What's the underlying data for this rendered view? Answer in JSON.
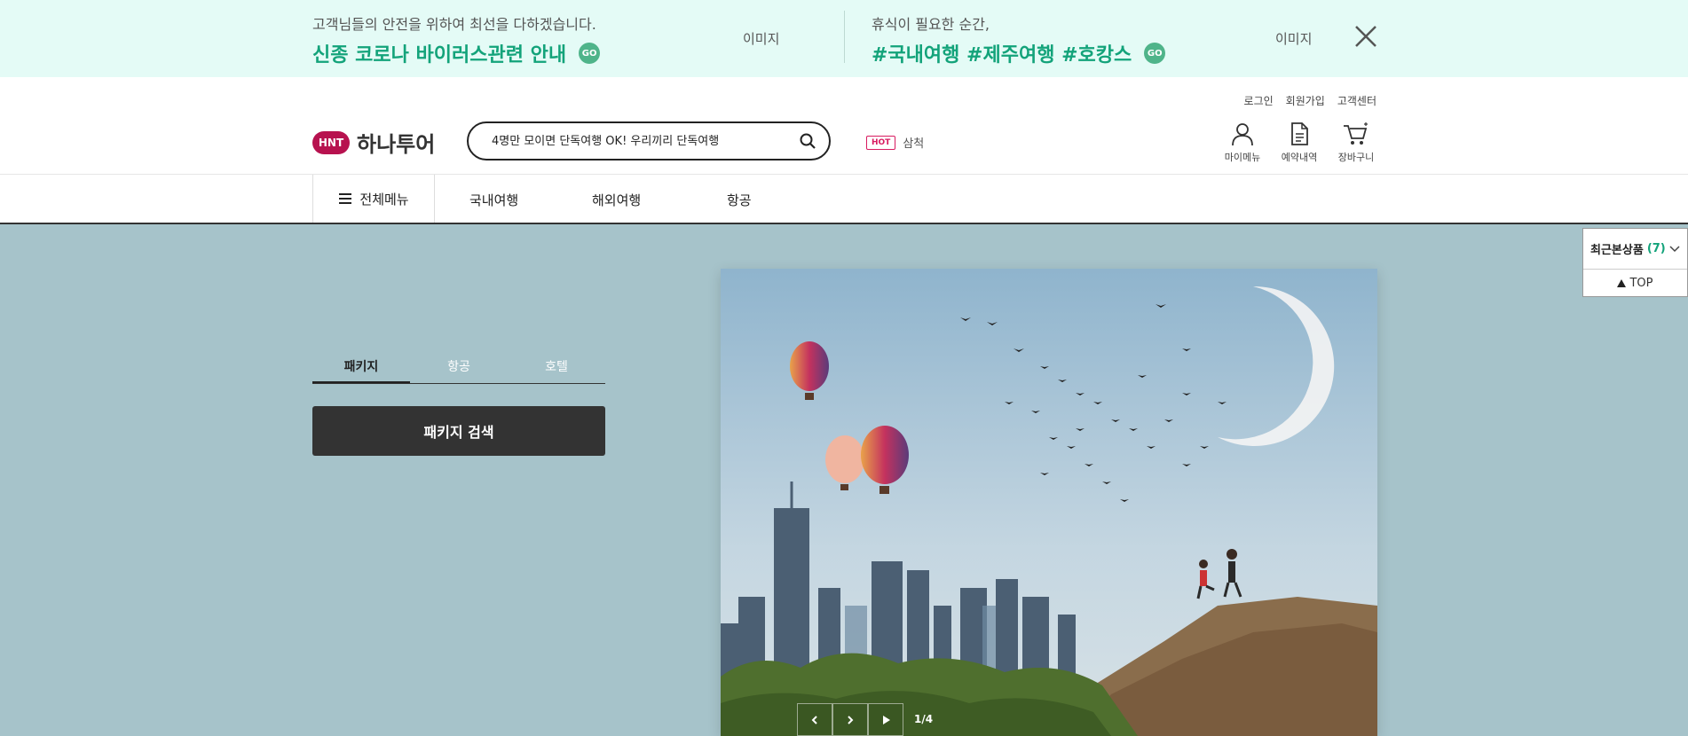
{
  "banner": {
    "left": {
      "sub": "고객님들의 안전을 위하여 최선을 다하겠습니다.",
      "main": "신종 코로나 바이러스관련 안내",
      "go": "GO",
      "image_label": "이미지"
    },
    "right": {
      "sub": "휴식이 필요한 순간,",
      "main": "#국내여행 #제주여행 #호캉스",
      "go": "GO",
      "image_label": "이미지"
    },
    "accent": "#13a37a",
    "background": "#e4fbf6"
  },
  "header": {
    "util": {
      "login": "로그인",
      "signup": "회원가입",
      "support": "고객센터"
    },
    "logo": {
      "mark": "HNT",
      "name": "하나투어"
    },
    "search": {
      "value": "4명만 모이면 단독여행 OK! 우리끼리 단독여행"
    },
    "hot": {
      "badge": "HOT",
      "keyword": "삼척"
    },
    "icons": [
      {
        "name": "user-icon",
        "label": "마이메뉴"
      },
      {
        "name": "document-icon",
        "label": "예약내역"
      },
      {
        "name": "cart-icon",
        "label": "장바구니"
      }
    ]
  },
  "nav": {
    "all_menu": "전체메뉴",
    "items": [
      "국내여행",
      "해외여행",
      "항공"
    ]
  },
  "search_panel": {
    "tabs": [
      {
        "label": "패키지",
        "active": true
      },
      {
        "label": "항공",
        "active": false
      },
      {
        "label": "호텔",
        "active": false
      }
    ],
    "button": "패키지 검색"
  },
  "hero": {
    "counter": "1/4"
  },
  "side": {
    "recent_label": "최근본상품",
    "recent_count": "(7)",
    "top_label": "TOP"
  },
  "colors": {
    "page_bg": "#a6c3ca",
    "brand": "#b7124f",
    "dark_button": "#333333"
  }
}
